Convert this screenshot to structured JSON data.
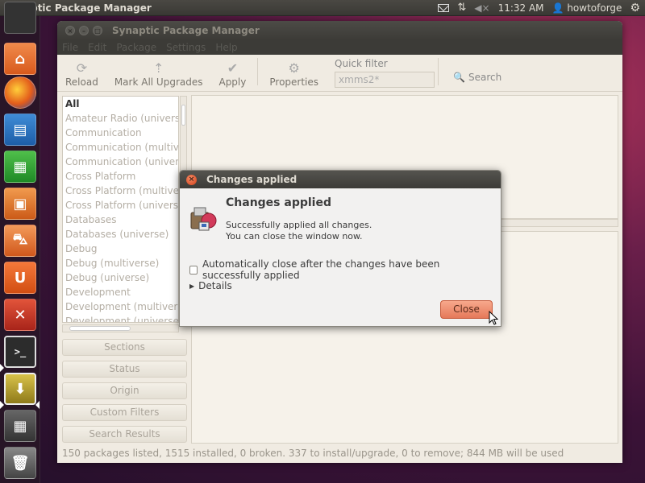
{
  "top_panel": {
    "app_title": "Synaptic Package Manager",
    "time": "11:32 AM",
    "user": "howtoforge"
  },
  "window": {
    "title": "Synaptic Package Manager",
    "menu": [
      "File",
      "Edit",
      "Package",
      "Settings",
      "Help"
    ],
    "toolbar": {
      "reload": "Reload",
      "mark_all": "Mark All Upgrades",
      "apply": "Apply",
      "properties": "Properties",
      "quick_filter_label": "Quick filter",
      "quick_filter_value": "xmms2*",
      "search": "Search"
    },
    "categories": [
      "All",
      "Amateur Radio (universe)",
      "Communication",
      "Communication (multivers",
      "Communication (universe)",
      "Cross Platform",
      "Cross Platform (multiverse",
      "Cross Platform (universe)",
      "Databases",
      "Databases (universe)",
      "Debug",
      "Debug (multiverse)",
      "Debug (universe)",
      "Development",
      "Development (multiverse)",
      "Development (universe)"
    ],
    "filter_buttons": {
      "sections": "Sections",
      "status": "Status",
      "origin": "Origin",
      "custom": "Custom Filters",
      "search_results": "Search Results"
    },
    "status": "150 packages listed, 1515 installed, 0 broken. 337 to install/upgrade, 0 to remove; 844 MB will be used"
  },
  "dialog": {
    "title": "Changes applied",
    "heading": "Changes applied",
    "line1": "Successfully applied all changes.",
    "line2": "You can close the window now.",
    "auto_close_label": "Automatically close after the changes have been successfully applied",
    "auto_close_checked": false,
    "details_label": "Details",
    "close_button": "Close"
  },
  "colors": {
    "accent_button": "#e5795a",
    "titlebar": "#3c3b37"
  }
}
